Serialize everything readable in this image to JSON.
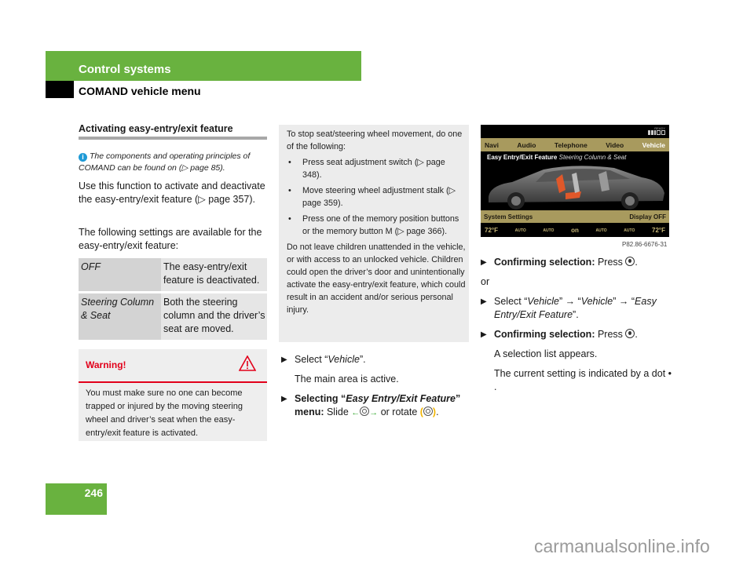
{
  "header": {
    "section": "Control systems",
    "subsection": "COMAND vehicle menu"
  },
  "column1": {
    "title": "Activating easy-entry/exit feature",
    "info_icon": "info-icon",
    "info_text": "The components and operating principles of COMAND can be found on (▷ page 85).",
    "para1": "Use this function to activate and deactivate the easy-entry/exit feature (▷ page 357).",
    "para2": "The following settings are available for the easy-entry/exit feature:",
    "settings_table": [
      {
        "setting": "OFF",
        "description": "The easy-entry/exit feature is deactivated."
      },
      {
        "setting": "Steering Column & Seat",
        "description": "Both the steering column and the driver’s seat are moved."
      }
    ],
    "warning": {
      "title": "Warning!",
      "icon": "warning-triangle-icon",
      "text": "You must make sure no one can become trapped or injured by the moving steering wheel and driver’s seat when the easy-entry/exit feature is activated."
    }
  },
  "column2": {
    "note_intro": "To stop seat/steering wheel movement, do one of the following:",
    "note_items": [
      "Press seat adjustment switch (▷ page 348).",
      "Move steering wheel adjustment stalk (▷ page 359).",
      "Press one of the memory position buttons or the memory button M (▷ page 366)."
    ],
    "note_warning": "Do not leave children unattended in the vehicle, or with access to an unlocked vehicle. Children could open the driver’s door and unintentionally activate the easy-entry/exit feature, which could result in an accident and/or serious personal injury.",
    "step1_pre": "Select “",
    "step1_item": "Vehicle",
    "step1_post": "”.",
    "step1_result": "The main area is active.",
    "step2_bold_pre": "Selecting “",
    "step2_item": "Easy Entry/Exit Feature",
    "step2_bold_post": "” menu:",
    "step2_slide": " Slide ",
    "step2_or": " or rotate ",
    "step2_end": "."
  },
  "screen": {
    "ready_label": "READY",
    "menu_items": [
      "Navi",
      "Audio",
      "Telephone",
      "Video",
      "Vehicle"
    ],
    "active_menu": "Vehicle",
    "crumb_title": "Easy Entry/Exit Feature",
    "crumb_value": "Steering Column & Seat",
    "system_settings": "System Settings",
    "display_off": "Display OFF",
    "climate": {
      "temp_left": "72°F",
      "auto1": "AUTO",
      "fan_left": "AUTO",
      "on": "on",
      "fan_right": "AUTO",
      "auto2": "AUTO",
      "temp_right": "72°F"
    },
    "figure_id": "P82.86-6676-31"
  },
  "column3": {
    "step1_bold": "Confirming selection:",
    "step1_text": " Press ",
    "or": "or",
    "step2_pre": "Select “",
    "step2_a": "Vehicle",
    "step2_mid": "” → “",
    "step2_b": "Vehicle",
    "step2_mid2": "” → “",
    "step2_c": "Easy Entry/Exit Feature",
    "step2_post": "”.",
    "step3_bold": "Confirming selection:",
    "step3_text": " Press ",
    "result1": "A selection list appears.",
    "result2": "The current setting is indicated by a dot • ."
  },
  "footer": {
    "page_number": "246",
    "watermark": "carmanualsonline.info"
  },
  "colors": {
    "brand_green": "#69b23f",
    "warning_red": "#e2001a",
    "info_blue": "#1e9ad6",
    "screen_gold": "#a89a5e"
  }
}
